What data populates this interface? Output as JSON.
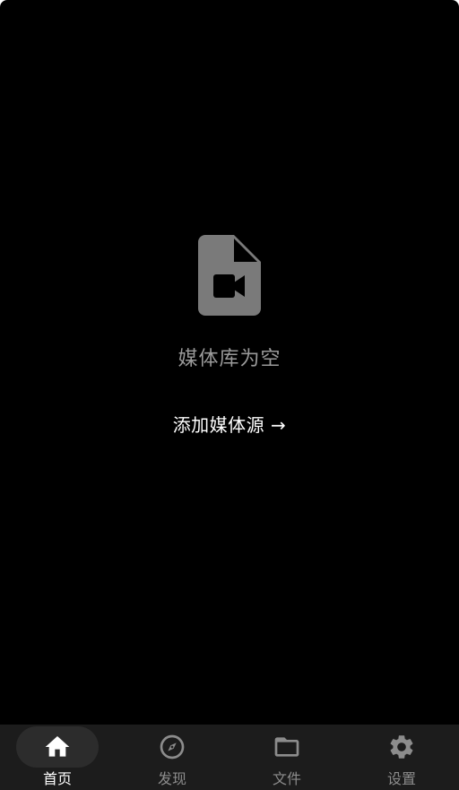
{
  "empty_state": {
    "icon": "video-file-icon",
    "title": "媒体库为空",
    "action_label": "添加媒体源 →"
  },
  "bottom_nav": {
    "active": "home",
    "items": [
      {
        "id": "home",
        "label": "首页",
        "icon": "home-icon"
      },
      {
        "id": "discover",
        "label": "发现",
        "icon": "compass-icon"
      },
      {
        "id": "files",
        "label": "文件",
        "icon": "folder-icon"
      },
      {
        "id": "settings",
        "label": "设置",
        "icon": "gear-icon"
      }
    ]
  },
  "colors": {
    "background": "#000000",
    "nav_background": "#1c1c1c",
    "nav_active_pill": "#2c2c2c",
    "icon_gray": "#7a7a7a",
    "nav_inactive": "#8c8c8c",
    "text_primary": "#ffffff",
    "text_muted": "#9a9a9a"
  }
}
